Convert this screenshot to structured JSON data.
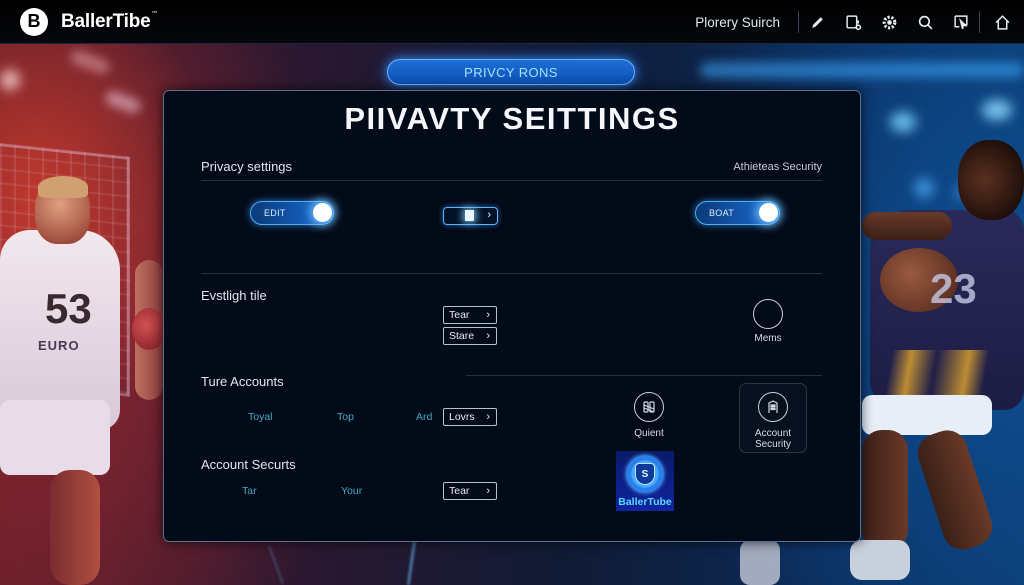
{
  "app": {
    "name": "BallerTibe",
    "logo_letter": "B",
    "trademark": "™"
  },
  "topbar": {
    "search_label": "Plorery Suirch",
    "icons": [
      "pencil-icon",
      "device-icon",
      "gear-icon",
      "search-icon",
      "cursor-box-icon",
      "home-icon"
    ]
  },
  "banner": {
    "label": "PRIVCY RONS"
  },
  "panel": {
    "title": "PIIVAVTY SEITTINGS",
    "sections": {
      "privacy": {
        "label": "Privacy settings",
        "right_label": "Athieteas Security",
        "toggle_left": {
          "label": "EDIT",
          "state": "on"
        },
        "slider": {
          "arrow": "›"
        },
        "toggle_right": {
          "label": "BOAT",
          "state": "on"
        }
      },
      "eventing": {
        "label": "Evstligh tile",
        "buttons": [
          {
            "label": "Tear"
          },
          {
            "label": "Stare"
          }
        ],
        "circle_caption": "Mems"
      },
      "accounts": {
        "label": "Ture Accounts",
        "links": [
          "Toyal",
          "Top",
          "Ard"
        ],
        "button": {
          "label": "Lovrs"
        },
        "quick_icon_caption": "Quient",
        "account_security_caption_line1": "Account",
        "account_security_caption_line2": "Security"
      },
      "security": {
        "label": "Account Securts",
        "links": [
          "Tar",
          "Your"
        ],
        "button": {
          "label": "Tear"
        }
      }
    },
    "badge": {
      "text": "BallerTube",
      "shield_letter": "S"
    }
  },
  "colors": {
    "accent": "#1a6ed8",
    "accent_glow": "#4bb0ff",
    "panel_bg": "#030a18",
    "teal_link": "#47a8c4",
    "badge_text": "#58d8ff"
  },
  "chevron": "›"
}
